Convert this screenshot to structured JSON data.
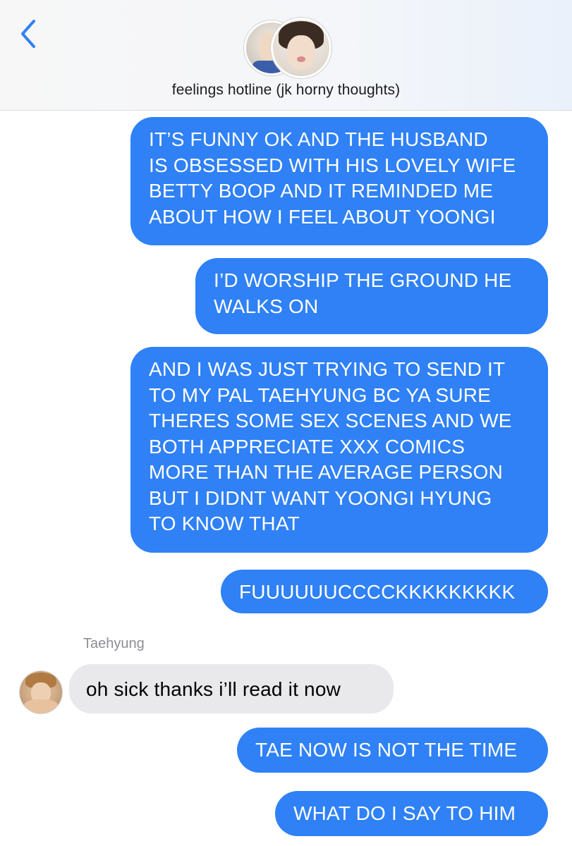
{
  "header": {
    "back_icon": "chevron-left-icon",
    "accent_color": "#2f81f5",
    "group_name": "feelings hotline (jk horny thoughts)"
  },
  "thread": {
    "sent_bubble_color": "#2f81f5",
    "received_bubble_color": "#e9e9eb",
    "messages": [
      {
        "direction": "sent",
        "text": "IT’S FUNNY OK AND THE HUSBAND\nIS OBSESSED WITH HIS LOVELY WIFE\nBETTY BOOP AND IT REMINDED ME\nABOUT HOW I FEEL ABOUT YOONGI"
      },
      {
        "direction": "sent",
        "text": "I’D WORSHIP THE GROUND HE\nWALKS ON"
      },
      {
        "direction": "sent",
        "text": "AND I WAS JUST TRYING TO SEND IT\nTO MY PAL TAEHYUNG BC YA SURE\nTHERES SOME SEX SCENES AND WE\nBOTH APPRECIATE XXX COMICS\nMORE THAN THE AVERAGE PERSON\nBUT I DIDNT WANT YOONGI HYUNG\nTO KNOW THAT"
      },
      {
        "direction": "sent",
        "text": "FUUUUUUCCCCKKKKKKKKK"
      },
      {
        "direction": "received",
        "sender": "Taehyung",
        "text": "oh sick thanks i’ll read it now"
      },
      {
        "direction": "sent",
        "text": "TAE NOW IS NOT THE TIME"
      },
      {
        "direction": "sent",
        "text": "WHAT DO I SAY TO HIM"
      }
    ]
  }
}
